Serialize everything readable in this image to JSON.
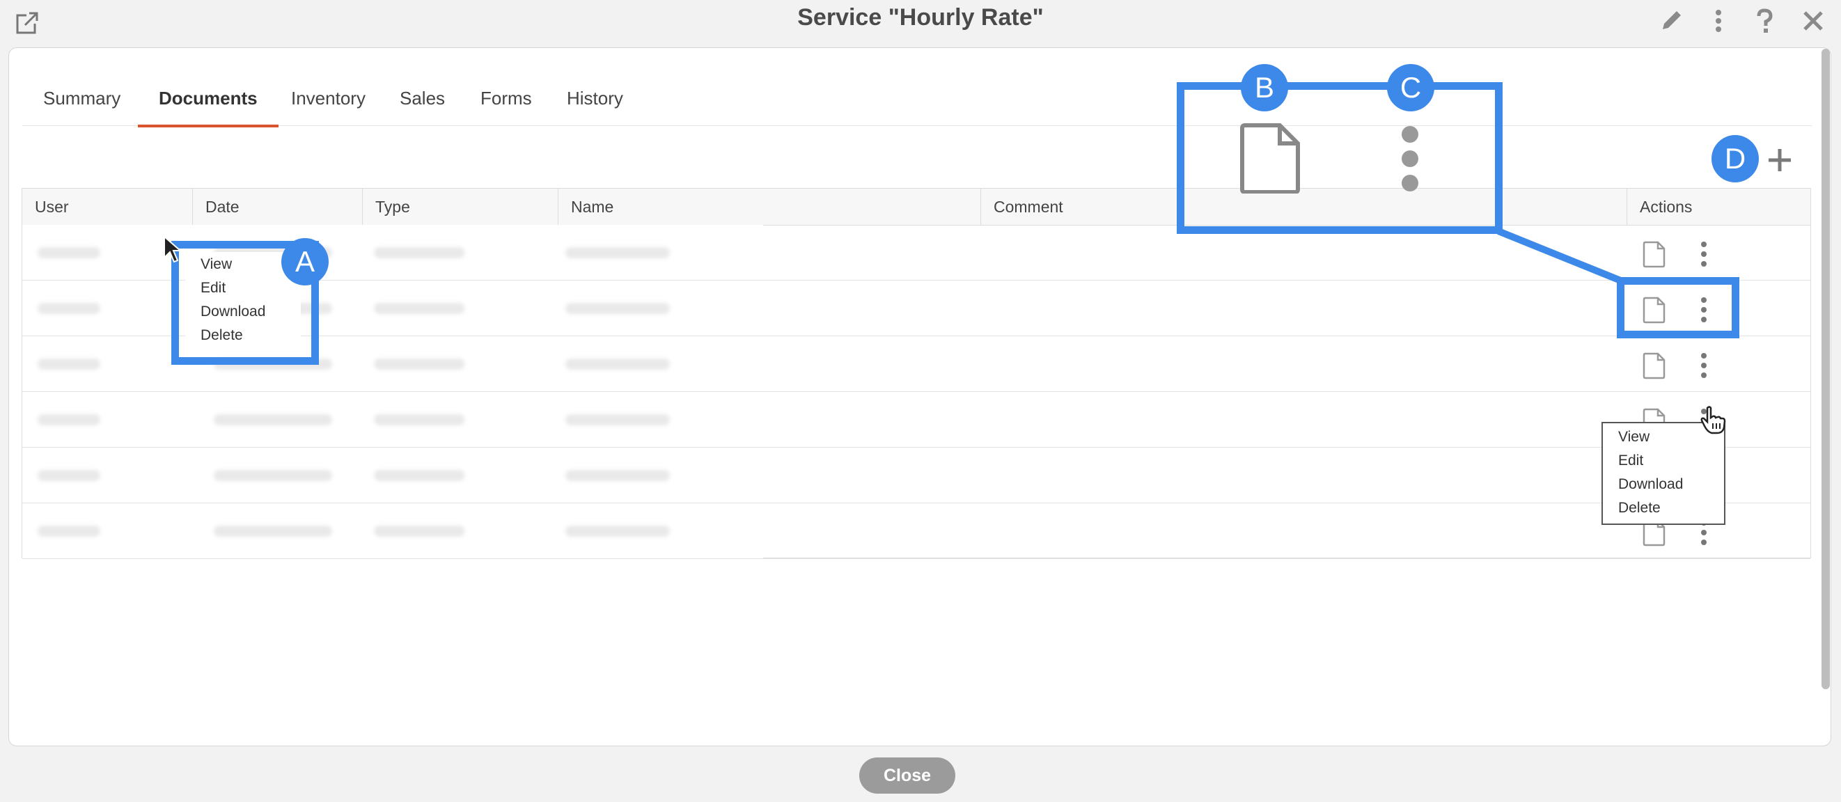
{
  "window": {
    "title": "Service \"Hourly Rate\"",
    "close_label": "Close"
  },
  "tabs": [
    {
      "label": "Summary",
      "active": false
    },
    {
      "label": "Documents",
      "active": true
    },
    {
      "label": "Inventory",
      "active": false
    },
    {
      "label": "Sales",
      "active": false
    },
    {
      "label": "Forms",
      "active": false
    },
    {
      "label": "History",
      "active": false
    }
  ],
  "table": {
    "columns": [
      "User",
      "Date",
      "Type",
      "Name",
      "Comment",
      "Actions"
    ],
    "row_count": 6
  },
  "menus": {
    "row_menu_items": [
      "View",
      "Edit",
      "Download",
      "Delete"
    ]
  },
  "annotations": {
    "badges": [
      "A",
      "B",
      "C",
      "D"
    ]
  },
  "colors": {
    "accent_tab": "#d9532c",
    "annotation": "#3d89ea",
    "close_button": "#9b9b9b"
  },
  "icons": [
    "popout-icon",
    "pencil-icon",
    "more-vertical-icon",
    "help-icon",
    "close-icon",
    "document-icon",
    "plus-icon"
  ]
}
